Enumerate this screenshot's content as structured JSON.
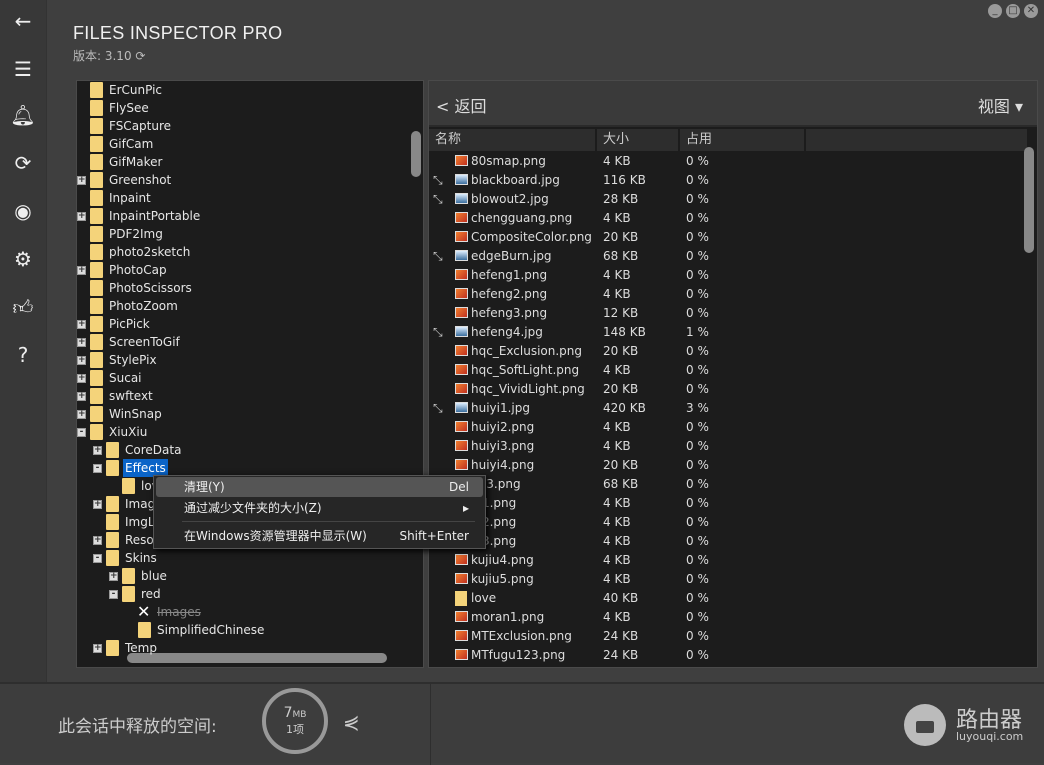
{
  "app": {
    "title": "FILES INSPECTOR PRO",
    "version_label": "版本: 3.10"
  },
  "window_controls": [
    "_",
    "□",
    "✕"
  ],
  "sidebar": [
    "arrow-left-icon",
    "menu-icon",
    "bell-icon",
    "refresh-icon",
    "lifebuoy-icon",
    "gear-icon",
    "thumbs-up-icon",
    "help-icon"
  ],
  "tree": {
    "items": [
      {
        "label": "ErCunPic",
        "level": 1,
        "exp": ""
      },
      {
        "label": "FlySee",
        "level": 1,
        "exp": ""
      },
      {
        "label": "FSCapture",
        "level": 1,
        "exp": ""
      },
      {
        "label": "GifCam",
        "level": 1,
        "exp": ""
      },
      {
        "label": "GifMaker",
        "level": 1,
        "exp": ""
      },
      {
        "label": "Greenshot",
        "level": 1,
        "exp": "+"
      },
      {
        "label": "Inpaint",
        "level": 1,
        "exp": ""
      },
      {
        "label": "InpaintPortable",
        "level": 1,
        "exp": "+"
      },
      {
        "label": "PDF2Img",
        "level": 1,
        "exp": ""
      },
      {
        "label": "photo2sketch",
        "level": 1,
        "exp": ""
      },
      {
        "label": "PhotoCap",
        "level": 1,
        "exp": "+"
      },
      {
        "label": "PhotoScissors",
        "level": 1,
        "exp": ""
      },
      {
        "label": "PhotoZoom",
        "level": 1,
        "exp": ""
      },
      {
        "label": "PicPick",
        "level": 1,
        "exp": "+"
      },
      {
        "label": "ScreenToGif",
        "level": 1,
        "exp": "+"
      },
      {
        "label": "StylePix",
        "level": 1,
        "exp": "+"
      },
      {
        "label": "Sucai",
        "level": 1,
        "exp": "+"
      },
      {
        "label": "swftext",
        "level": 1,
        "exp": "+"
      },
      {
        "label": "WinSnap",
        "level": 1,
        "exp": "+"
      },
      {
        "label": "XiuXiu",
        "level": 1,
        "exp": "-"
      },
      {
        "label": "CoreData",
        "level": 2,
        "exp": "+"
      },
      {
        "label": "Effects",
        "level": 2,
        "exp": "-",
        "selected": true
      },
      {
        "label": "lov",
        "level": 3,
        "exp": ""
      },
      {
        "label": "Imag",
        "level": 2,
        "exp": "+"
      },
      {
        "label": "ImgL",
        "level": 2,
        "exp": ""
      },
      {
        "label": "Resou",
        "level": 2,
        "exp": "+"
      },
      {
        "label": "Skins",
        "level": 2,
        "exp": "-"
      },
      {
        "label": "blue",
        "level": 3,
        "exp": "+"
      },
      {
        "label": "red",
        "level": 3,
        "exp": "-"
      },
      {
        "label": "Images",
        "level": 4,
        "exp": "",
        "deleted": true
      },
      {
        "label": "SimplifiedChinese",
        "level": 4,
        "exp": ""
      },
      {
        "label": "Temp",
        "level": 2,
        "exp": "+"
      }
    ]
  },
  "panel": {
    "back_label": "< 返回",
    "view_label": "视图 ▾"
  },
  "table": {
    "headers": [
      "名称",
      "大小",
      "占用"
    ],
    "rows": [
      [
        "80smap.png",
        "4 KB",
        "0 %",
        "png",
        false
      ],
      [
        "blackboard.jpg",
        "116 KB",
        "0 %",
        "jpg",
        true
      ],
      [
        "blowout2.jpg",
        "28 KB",
        "0 %",
        "jpg",
        true
      ],
      [
        "chengguang.png",
        "4 KB",
        "0 %",
        "png",
        false
      ],
      [
        "CompositeColor.png",
        "20 KB",
        "0 %",
        "png",
        false
      ],
      [
        "edgeBurn.jpg",
        "68 KB",
        "0 %",
        "jpg",
        true
      ],
      [
        "hefeng1.png",
        "4 KB",
        "0 %",
        "png",
        false
      ],
      [
        "hefeng2.png",
        "4 KB",
        "0 %",
        "png",
        false
      ],
      [
        "hefeng3.png",
        "12 KB",
        "0 %",
        "png",
        false
      ],
      [
        "hefeng4.jpg",
        "148 KB",
        "1 %",
        "jpg",
        true
      ],
      [
        "hqc_Exclusion.png",
        "20 KB",
        "0 %",
        "png",
        false
      ],
      [
        "hqc_SoftLight.png",
        "4 KB",
        "0 %",
        "png",
        false
      ],
      [
        "hqc_VividLight.png",
        "20 KB",
        "0 %",
        "png",
        false
      ],
      [
        "huiyi1.jpg",
        "420 KB",
        "3 %",
        "jpg",
        true
      ],
      [
        "huiyi2.png",
        "4 KB",
        "0 %",
        "png",
        false
      ],
      [
        "huiyi3.png",
        "4 KB",
        "0 %",
        "png",
        false
      ],
      [
        "huiyi4.png",
        "20 KB",
        "0 %",
        "png",
        false
      ],
      [
        "123.png",
        "68 KB",
        "0 %",
        "png",
        false
      ],
      [
        "iu1.png",
        "4 KB",
        "0 %",
        "png",
        false
      ],
      [
        "iu2.png",
        "4 KB",
        "0 %",
        "png",
        false
      ],
      [
        "iu3.png",
        "4 KB",
        "0 %",
        "png",
        false
      ],
      [
        "kujiu4.png",
        "4 KB",
        "0 %",
        "png",
        false
      ],
      [
        "kujiu5.png",
        "4 KB",
        "0 %",
        "png",
        false
      ],
      [
        "love",
        "40 KB",
        "0 %",
        "dir",
        false
      ],
      [
        "moran1.png",
        "4 KB",
        "0 %",
        "png",
        false
      ],
      [
        "MTExclusion.png",
        "24 KB",
        "0 %",
        "png",
        false
      ],
      [
        "MTfugu123.png",
        "24 KB",
        "0 %",
        "png",
        false
      ]
    ]
  },
  "context_menu": {
    "items": [
      {
        "label": "清理(Y)",
        "key": "Del"
      },
      {
        "label": "通过减少文件夹的大小(Z)",
        "key": "▸"
      },
      {
        "label": "在Windows资源管理器中显示(W)",
        "key": "Shift+Enter"
      }
    ]
  },
  "footer": {
    "freed_label": "此会话中释放的空间:",
    "freed_value": "7",
    "freed_unit": "MB",
    "freed_count": "1项",
    "watermark_name": "路由器",
    "watermark_url": "luyouqi.com"
  }
}
